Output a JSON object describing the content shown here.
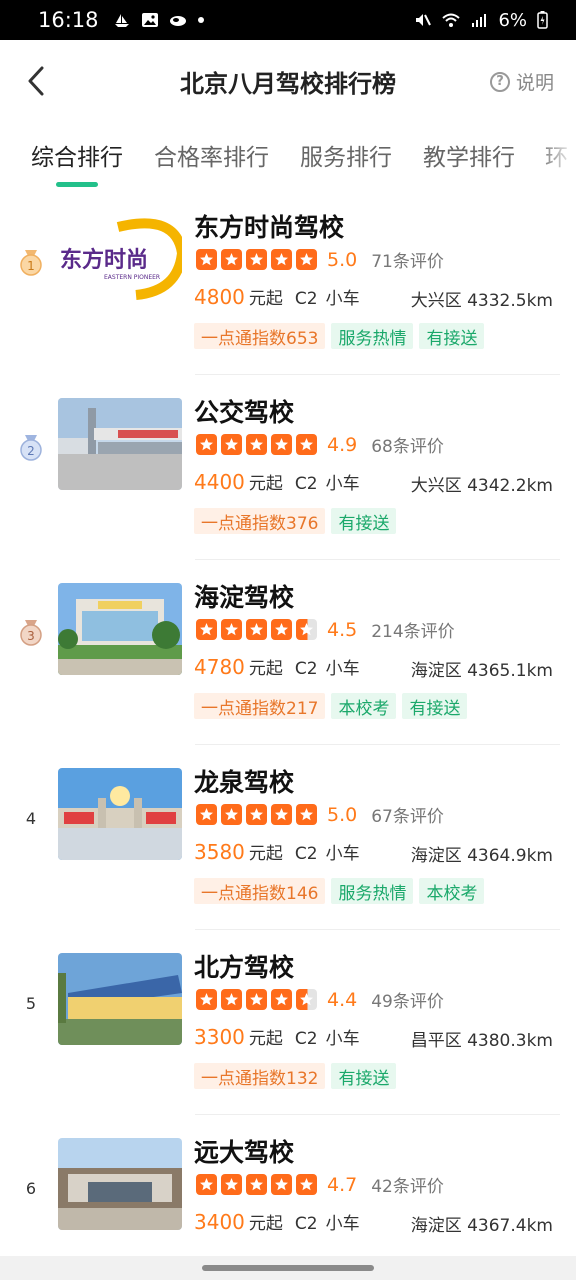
{
  "status": {
    "time": "16:18",
    "battery": "6%",
    "left_icons": [
      "boat-icon",
      "image-icon",
      "cloud-icon",
      "dot-icon"
    ],
    "right_icons": [
      "mute-icon",
      "wifi-icon",
      "signal-icon",
      "battery-icon"
    ]
  },
  "header": {
    "title": "北京八月驾校排行榜",
    "help_label": "说明"
  },
  "tabs": [
    {
      "label": "综合排行",
      "active": true
    },
    {
      "label": "合格率排行",
      "active": false
    },
    {
      "label": "服务排行",
      "active": false
    },
    {
      "label": "教学排行",
      "active": false
    },
    {
      "label": "环",
      "active": false
    }
  ],
  "colors": {
    "accent_green": "#22c08a",
    "price_orange": "#ff7a1a",
    "star_orange": "#ff6b1a"
  },
  "schools": [
    {
      "rank": "1",
      "rank_type": "gold-medal",
      "name": "东方时尚驾校",
      "thumb_logo_main": "东方时尚",
      "thumb_logo_sub": "EASTERN PIONEER",
      "stars": 5,
      "score": "5.0",
      "reviews": "71条评价",
      "price": "4800",
      "price_unit": "元起",
      "license": "C2",
      "vehicle": "小车",
      "location": "大兴区 4332.5km",
      "tags": [
        {
          "text": "一点通指数653",
          "style": "orange"
        },
        {
          "text": "服务热情",
          "style": "green"
        },
        {
          "text": "有接送",
          "style": "green"
        }
      ]
    },
    {
      "rank": "2",
      "rank_type": "silver-medal",
      "name": "公交驾校",
      "stars": 5,
      "score": "4.9",
      "reviews": "68条评价",
      "price": "4400",
      "price_unit": "元起",
      "license": "C2",
      "vehicle": "小车",
      "location": "大兴区 4342.2km",
      "tags": [
        {
          "text": "一点通指数376",
          "style": "orange"
        },
        {
          "text": "有接送",
          "style": "green"
        }
      ]
    },
    {
      "rank": "3",
      "rank_type": "bronze-medal",
      "name": "海淀驾校",
      "stars": 4.5,
      "score": "4.5",
      "reviews": "214条评价",
      "price": "4780",
      "price_unit": "元起",
      "license": "C2",
      "vehicle": "小车",
      "location": "海淀区 4365.1km",
      "tags": [
        {
          "text": "一点通指数217",
          "style": "orange"
        },
        {
          "text": "本校考",
          "style": "green"
        },
        {
          "text": "有接送",
          "style": "green"
        }
      ]
    },
    {
      "rank": "4",
      "rank_type": "number",
      "name": "龙泉驾校",
      "stars": 5,
      "score": "5.0",
      "reviews": "67条评价",
      "price": "3580",
      "price_unit": "元起",
      "license": "C2",
      "vehicle": "小车",
      "location": "海淀区 4364.9km",
      "tags": [
        {
          "text": "一点通指数146",
          "style": "orange"
        },
        {
          "text": "服务热情",
          "style": "green"
        },
        {
          "text": "本校考",
          "style": "green"
        }
      ]
    },
    {
      "rank": "5",
      "rank_type": "number",
      "name": "北方驾校",
      "stars": 4.5,
      "score": "4.4",
      "reviews": "49条评价",
      "price": "3300",
      "price_unit": "元起",
      "license": "C2",
      "vehicle": "小车",
      "location": "昌平区 4380.3km",
      "tags": [
        {
          "text": "一点通指数132",
          "style": "orange"
        },
        {
          "text": "有接送",
          "style": "green"
        }
      ]
    },
    {
      "rank": "6",
      "rank_type": "number",
      "name": "远大驾校",
      "stars": 5,
      "score": "4.7",
      "reviews": "42条评价",
      "price": "3400",
      "price_unit": "元起",
      "license": "C2",
      "vehicle": "小车",
      "location": "海淀区 4367.4km",
      "tags": []
    }
  ]
}
